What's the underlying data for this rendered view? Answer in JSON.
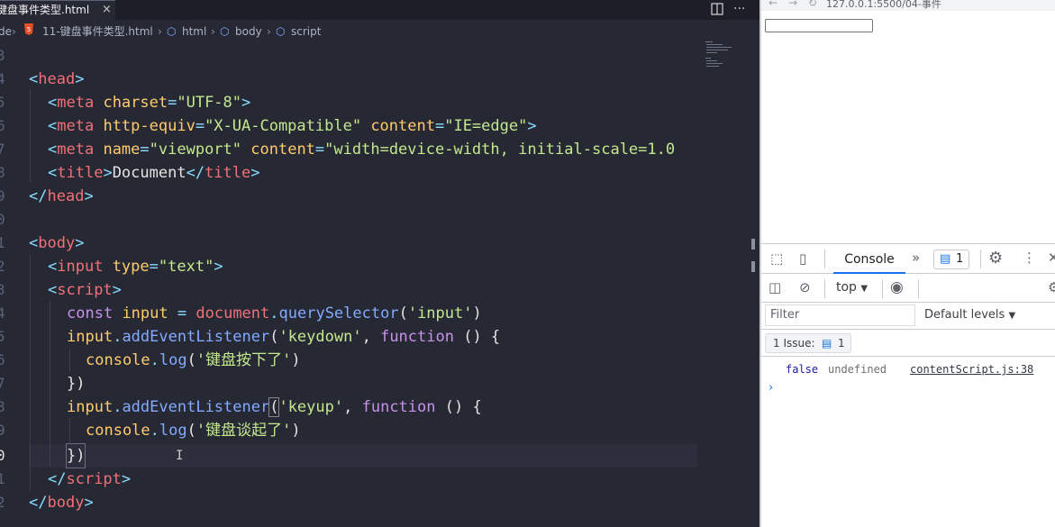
{
  "editor": {
    "tab": {
      "label": "键盘事件类型.html",
      "close": "×"
    },
    "breadcrumb": {
      "root": "de",
      "file": "11-键盘事件类型.html",
      "html": "html",
      "body": "body",
      "script": "script"
    },
    "line_numbers": [
      "3",
      "4",
      "5",
      "6",
      "7",
      "8",
      "9",
      "0",
      "1",
      "2",
      "3",
      "4",
      "5",
      "6",
      "7",
      "8",
      "9",
      "0",
      "1",
      "2"
    ],
    "code": {
      "l0": "",
      "l1_tag_open": "<",
      "l1_tag": "head",
      "l1_tag_close": ">",
      "l2_lt": "<",
      "l2_tag": "meta",
      "l2_attr": "charset",
      "l2_eq": "=",
      "l2_val": "\"UTF-8\"",
      "l2_gt": ">",
      "l3_lt": "<",
      "l3_tag": "meta",
      "l3_attr1": "http-equiv",
      "l3_eq1": "=",
      "l3_val1": "\"X-UA-Compatible\"",
      "l3_attr2": "content",
      "l3_eq2": "=",
      "l3_val2": "\"IE=edge\"",
      "l3_gt": ">",
      "l4_lt": "<",
      "l4_tag": "meta",
      "l4_attr1": "name",
      "l4_eq1": "=",
      "l4_val1": "\"viewport\"",
      "l4_attr2": "content",
      "l4_eq2": "=",
      "l4_val2": "\"width=device-width, initial-scale=1.0",
      "l5_lt": "<",
      "l5_tag": "title",
      "l5_gt": ">",
      "l5_text": "Document",
      "l5_lt2": "</",
      "l5_tag2": "title",
      "l5_gt2": ">",
      "l6_lt": "</",
      "l6_tag": "head",
      "l6_gt": ">",
      "l8_lt": "<",
      "l8_tag": "body",
      "l8_gt": ">",
      "l9_lt": "<",
      "l9_tag": "input",
      "l9_attr": "type",
      "l9_eq": "=",
      "l9_val": "\"text\"",
      "l9_gt": ">",
      "l10_lt": "<",
      "l10_tag": "script",
      "l10_gt": ">",
      "l11_kw": "const",
      "l11_var": "input",
      "l11_eq": "=",
      "l11_obj": "document",
      "l11_dot": ".",
      "l11_fn": "querySelector",
      "l11_p1": "(",
      "l11_str": "'input'",
      "l11_p2": ")",
      "l12_var": "input",
      "l12_dot": ".",
      "l12_fn": "addEventListener",
      "l12_p1": "(",
      "l12_str": "'keydown'",
      "l12_comma": ",",
      "l12_kw": "function",
      "l12_rest": "() {",
      "l13_obj": "console",
      "l13_dot": ".",
      "l13_fn": "log",
      "l13_p1": "(",
      "l13_str": "'键盘按下了'",
      "l13_p2": ")",
      "l14_close": "})",
      "l15_var": "input",
      "l15_dot": ".",
      "l15_fn": "addEventListener",
      "l15_p1": "(",
      "l15_str": "'keyup'",
      "l15_comma": ",",
      "l15_kw": "function",
      "l15_rest": "() {",
      "l16_obj": "console",
      "l16_dot": ".",
      "l16_fn": "log",
      "l16_p1": "(",
      "l16_str": "'键盘谈起了'",
      "l16_p2": ")",
      "l17_close": "})",
      "l18_lt": "</",
      "l18_tag": "script",
      "l18_gt": ">",
      "l19_lt": "</",
      "l19_tag": "body",
      "l19_gt": ">"
    }
  },
  "browser": {
    "url": "127.0.0.1:5500/04-事件",
    "devtools": {
      "console_tab": "Console",
      "issue_count": "1",
      "context": "top",
      "filter_placeholder": "Filter",
      "levels": "Default levels",
      "issues_label": "1 Issue:",
      "issues_count": "1",
      "log": {
        "v1": "false",
        "v2": "undefined",
        "source": "contentScript.js:38"
      }
    }
  },
  "colors": {
    "editor_bg": "#262834",
    "tag": "#f07178",
    "string": "#c3e88d",
    "keyword": "#c792ea",
    "function": "#82aaff",
    "accent": "#1a73e8"
  }
}
